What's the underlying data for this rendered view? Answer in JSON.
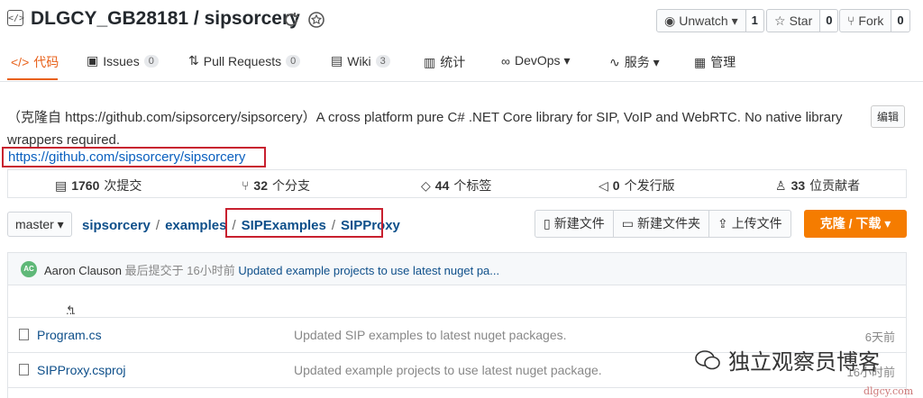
{
  "repo": {
    "title": "DLGCY_GB28181 / sipsorcery"
  },
  "header_buttons": {
    "watch_label": "Unwatch ▾",
    "watch_count": "1",
    "star_label": "Star",
    "star_count": "0",
    "fork_label": "Fork",
    "fork_count": "0"
  },
  "tabs": [
    {
      "label": "代码"
    },
    {
      "label": "Issues",
      "badge": "0"
    },
    {
      "label": "Pull Requests",
      "badge": "0"
    },
    {
      "label": "Wiki",
      "badge": "3"
    },
    {
      "label": "统计"
    },
    {
      "label": "DevOps ▾"
    },
    {
      "label": "服务 ▾"
    },
    {
      "label": "管理"
    }
  ],
  "description": "（克隆自 https://github.com/sipsorcery/sipsorcery）A cross platform pure C# .NET Core library for SIP, VoIP and WebRTC. No native library wrappers required.",
  "edit_label": "编辑",
  "homepage": "https://github.com/sipsorcery/sipsorcery",
  "stats": {
    "commits_num": "1760",
    "commits_label": "次提交",
    "branches_num": "32",
    "branches_label": "个分支",
    "tags_num": "44",
    "tags_label": "个标签",
    "releases_num": "0",
    "releases_label": "个发行版",
    "contributors_num": "33",
    "contributors_label": "位贡献者"
  },
  "branch": "master ▾",
  "breadcrumb": [
    "sipsorcery",
    "examples",
    "SIPExamples",
    "SIPProxy"
  ],
  "file_actions": {
    "new_file": "新建文件",
    "new_folder": "新建文件夹",
    "upload": "上传文件",
    "clone": "克隆 / 下载 ▾"
  },
  "commit": {
    "avatar": "AC",
    "author": "Aaron Clauson",
    "when": "最后提交于 16小时前",
    "message": "Updated example projects to use latest nuget pa..."
  },
  "parent_label": "...",
  "files": [
    {
      "name": "Program.cs",
      "message": "Updated SIP examples to latest nuget packages.",
      "time": "6天前"
    },
    {
      "name": "SIPProxy.csproj",
      "message": "Updated example projects to use latest nuget package.",
      "time": "16小时前"
    }
  ],
  "watermark": {
    "text": "独立观察员博客",
    "url": "dlgcy.com"
  }
}
